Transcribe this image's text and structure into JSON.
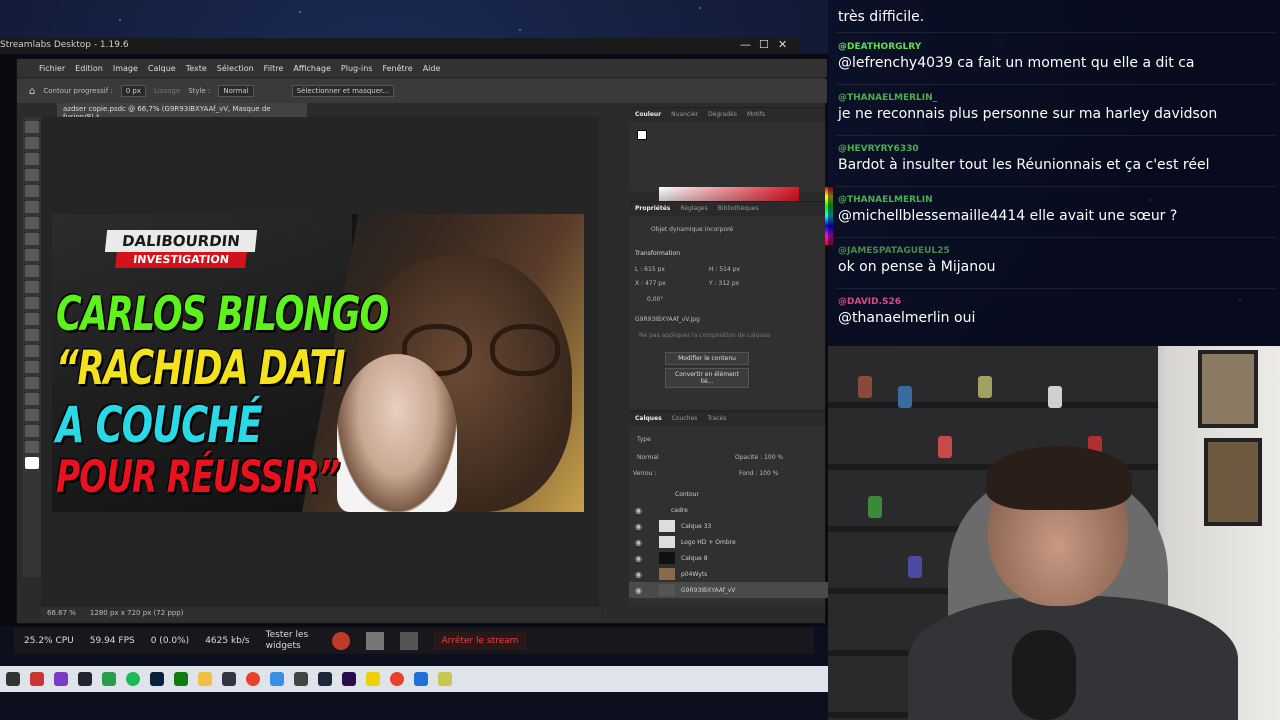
{
  "streamlabs": {
    "title": "Streamlabs Desktop - 1.19.6",
    "controls": {
      "minimize": "—",
      "maximize": "☐",
      "close": "✕"
    },
    "bottom_bar": {
      "cpu": "25.2% CPU",
      "fps": "59.94 FPS",
      "dropped": "0 (0.0%)",
      "bitrate": "4625 kb/s",
      "test_widgets": "Tester les widgets",
      "stop_stream": "Arrêter le stream"
    }
  },
  "photoshop": {
    "menu": [
      "Fichier",
      "Edition",
      "Image",
      "Calque",
      "Texte",
      "Sélection",
      "Filtre",
      "Affichage",
      "Plug-ins",
      "Fenêtre",
      "Aide"
    ],
    "options": {
      "contour_label": "Contour progressif :",
      "contour_value": "0 px",
      "lissage": "Lissage",
      "style_label": "Style :",
      "style_value": "Normal",
      "select_mask": "Sélectionner et masquer..."
    },
    "doc_tab": "azdser copie.psdc @ 66,7% (G9R93IBXYAAf_vV, Masque de fusion/8) *",
    "zoom": "66.67 %",
    "doc_size": "1280 px x 720 px (72 ppp)",
    "panels": {
      "color_tabs": [
        "Couleur",
        "Nuancier",
        "Dégradés",
        "Motifs"
      ],
      "props_tabs": [
        "Propriétés",
        "Réglages",
        "Bibliothèques"
      ],
      "smart_object": "Objet dynamique incorporé",
      "transformation": "Transformation",
      "L": "L : 615 px",
      "H": "H : 514 px",
      "X": "X : 477 px",
      "Y": "Y : 312 px",
      "angle": "0,00°",
      "file": "G9R93IBXYAAf_vV.jpg",
      "comp": "Ne pas appliquer la composition de calques",
      "edit_content": "Modifier le contenu",
      "convert": "Convertir en élément lié...",
      "layers_tabs": [
        "Calques",
        "Couches",
        "Tracés"
      ],
      "kind": "Type",
      "blend": "Normal",
      "opacity": "Opacité : 100 %",
      "lock": "Verrou :",
      "fill": "Fond : 100 %",
      "layers": [
        "Contour",
        "cadre",
        "Calque 33",
        "Logo HD + Ombre",
        "Calque 8",
        "p04Wyts",
        "G9R93IBXYAAf_vV"
      ]
    }
  },
  "thumbnail": {
    "logo_top": "DALIBOURDIN",
    "logo_bottom": "INVESTIGATION",
    "line1": "CARLOS BILONGO",
    "line2": "“RACHIDA DATI",
    "line3_a": "A ",
    "line3_b": "COUCHÉ",
    "line4": "POUR RÉUSSIR”"
  },
  "chat": [
    {
      "user": "",
      "color": "#7ce05a",
      "text": "très difficile."
    },
    {
      "user": "@DEATHORGLRY",
      "color": "#5fe04a",
      "text": "@lefrenchy4039 ca fait un moment qu elle a dit ca"
    },
    {
      "user": "@THANAELMERLIN_",
      "color": "#4ab04a",
      "text": "je ne reconnais plus personne sur ma harley davidson"
    },
    {
      "user": "@HEVRYRY6330",
      "color": "#4ab04a",
      "text": "Bardot à insulter tout les Réunionnais et ça c'est réel"
    },
    {
      "user": "@THANAELMERLIN",
      "color": "#4ab04a",
      "text": "@michellblessemaille4414 elle avait une sœur ?"
    },
    {
      "user": "@JAMESPATAGUEUL25",
      "color": "#4a8a4a",
      "text": "ok on pense à Mijanou"
    },
    {
      "user": "@DAVID.S26",
      "color": "#d84a8a",
      "text": "@thanaelmerlin oui"
    }
  ],
  "colors": {
    "accent_green": "#5df21b",
    "accent_red": "#e8121f",
    "stream_stop": "#e8404a"
  }
}
